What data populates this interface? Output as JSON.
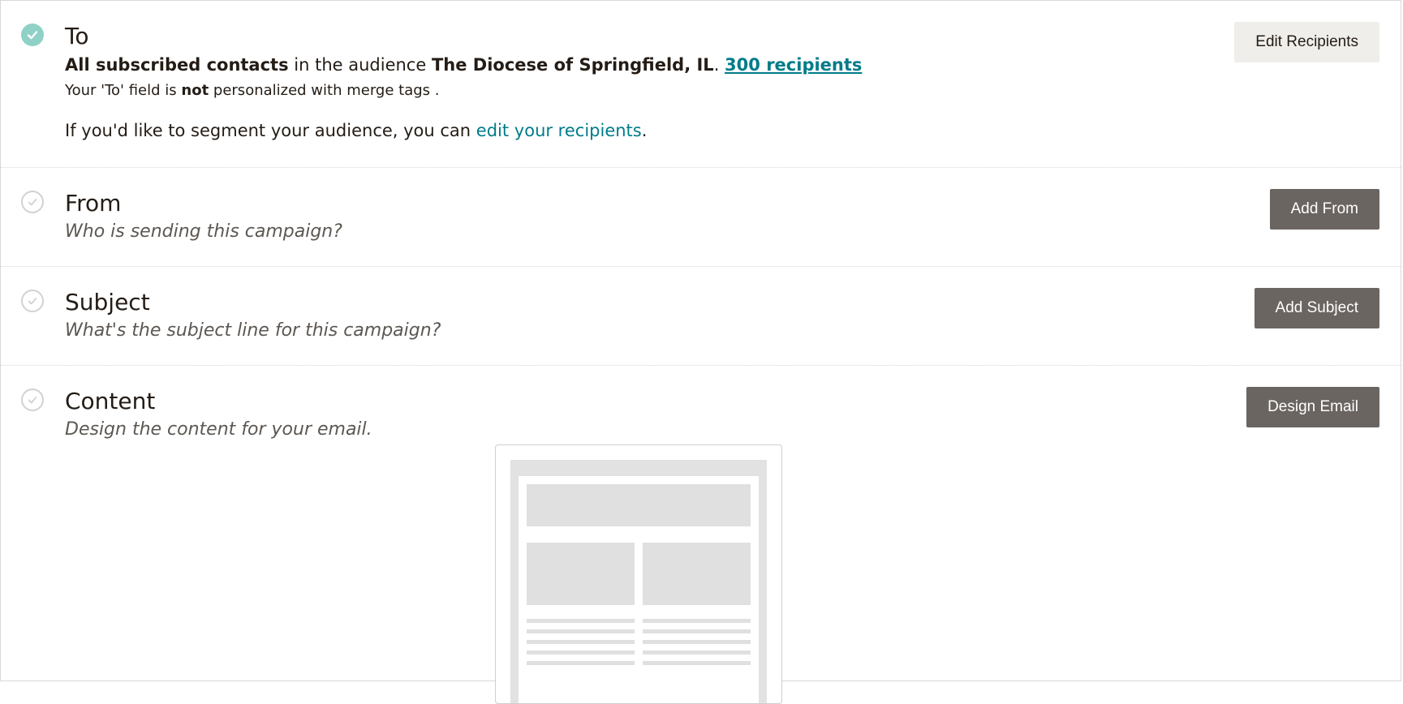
{
  "sections": {
    "to": {
      "title": "To",
      "line1": {
        "bold_contacts": "All subscribed contacts",
        "middle": " in the audience ",
        "bold_audience": "The Diocese of Springfield, IL",
        "dot": ". ",
        "recipients_link": "300 recipients"
      },
      "line2": {
        "prefix": "Your 'To' field is ",
        "bold": "not",
        "suffix": " personalized with merge tags ."
      },
      "line3": {
        "prefix": "If you'd like to segment your audience, you can ",
        "link": "edit your recipients",
        "suffix": "."
      },
      "button": "Edit Recipients"
    },
    "from": {
      "title": "From",
      "subtitle": "Who is sending this campaign?",
      "button": "Add From"
    },
    "subject": {
      "title": "Subject",
      "subtitle": "What's the subject line for this campaign?",
      "button": "Add Subject"
    },
    "content": {
      "title": "Content",
      "subtitle": "Design the content for your email.",
      "button": "Design Email"
    }
  },
  "colors": {
    "check_done": "#8fd1c6",
    "link": "#007c89",
    "button_dark": "#6b6561",
    "button_light": "#efeeea"
  },
  "icons": {
    "done": "check-circle-filled-icon",
    "todo": "check-circle-outline-icon"
  }
}
